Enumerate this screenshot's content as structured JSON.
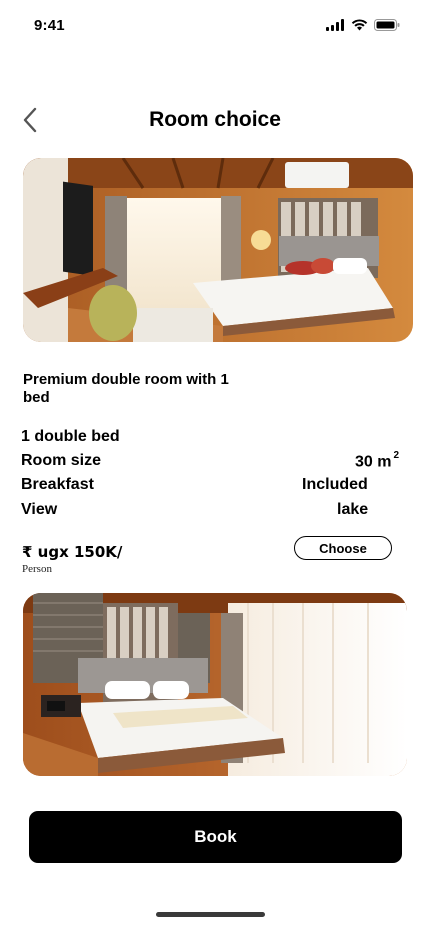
{
  "status_bar": {
    "time": "9:41"
  },
  "header": {
    "title": "Room choice"
  },
  "room": {
    "name": "Premium double room with 1 bed",
    "bed": "1 double bed",
    "size_label": "Room size",
    "size_value": "30 m",
    "size_unit_sup": "2",
    "breakfast_label": "Breakfast",
    "breakfast_value": "Included",
    "view_label": "View",
    "view_value": "lake",
    "price": "₹ ugx 150K/",
    "price_unit": "Person",
    "choose_label": "Choose"
  },
  "actions": {
    "book_label": "Book"
  },
  "colors": {
    "primary_button": "#000000",
    "wood": "#b5652a",
    "background": "#ffffff"
  }
}
